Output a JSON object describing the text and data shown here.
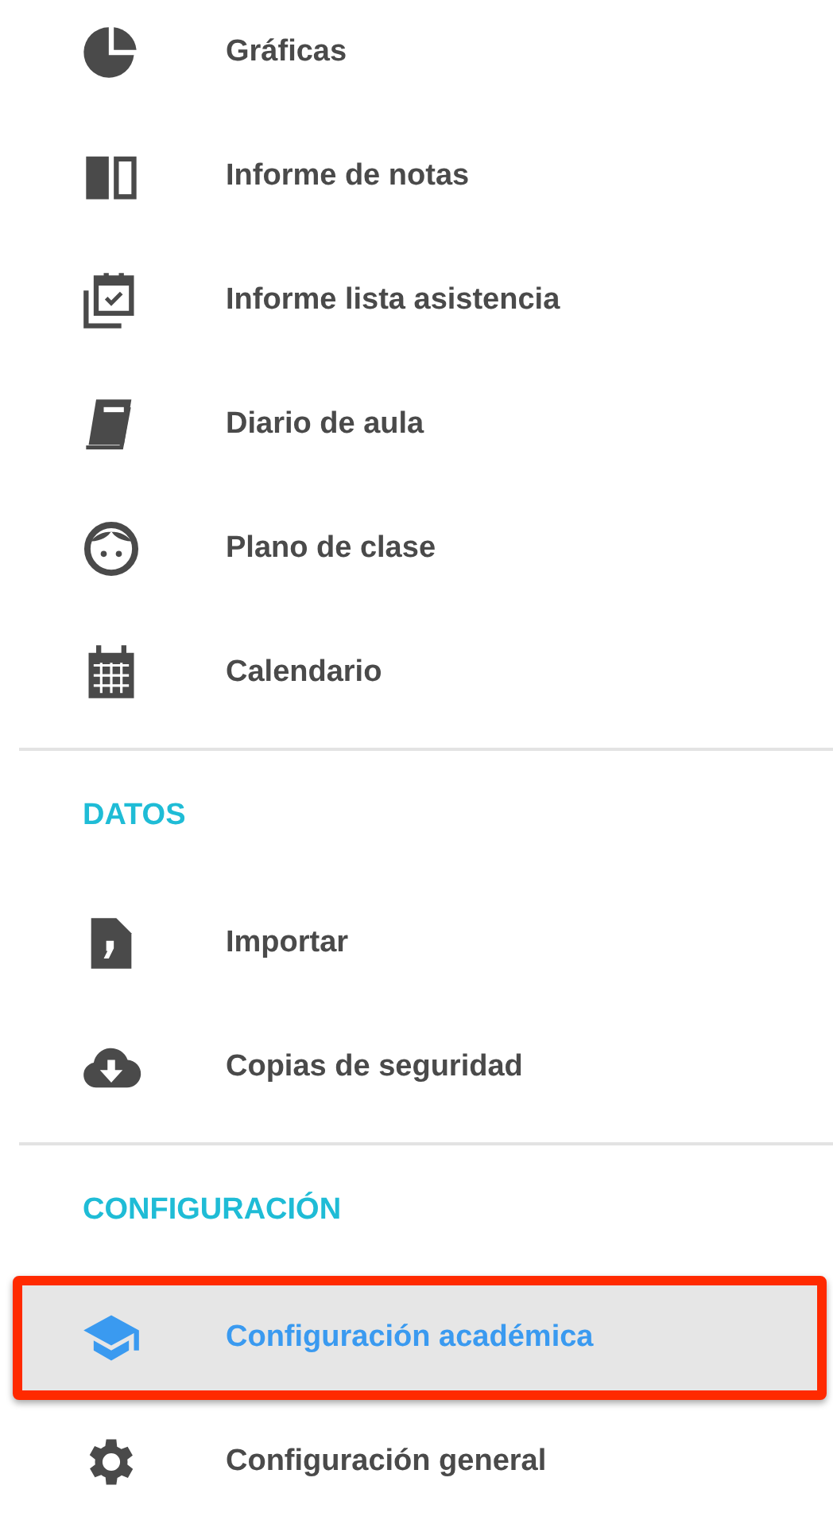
{
  "sections": [
    {
      "items": [
        {
          "label": "Gráficas",
          "selected": false
        },
        {
          "label": "Informe de notas",
          "selected": false
        },
        {
          "label": "Informe lista asistencia",
          "selected": false
        },
        {
          "label": "Diario de aula",
          "selected": false
        },
        {
          "label": "Plano de clase",
          "selected": false
        },
        {
          "label": "Calendario",
          "selected": false
        }
      ]
    },
    {
      "header": "DATOS",
      "items": [
        {
          "label": "Importar",
          "selected": false
        },
        {
          "label": "Copias de seguridad",
          "selected": false
        }
      ]
    },
    {
      "header": "CONFIGURACIÓN",
      "items": [
        {
          "label": "Configuración académica",
          "selected": true,
          "highlighted": true
        },
        {
          "label": "Configuración general",
          "selected": false
        }
      ]
    }
  ]
}
